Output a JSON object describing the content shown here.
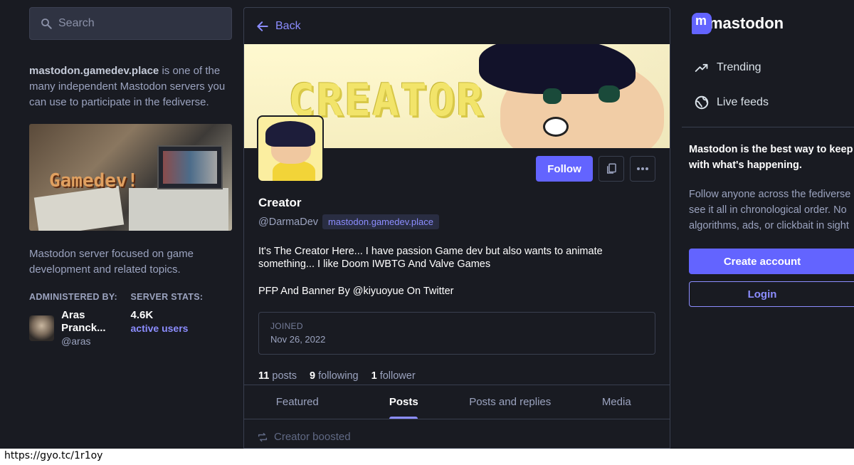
{
  "search": {
    "placeholder": "Search"
  },
  "server_info": {
    "domain": "mastodon.gamedev.place",
    "intro_rest": " is one of the many independent Mastodon servers you can use to participate in the fediverse.",
    "hero_text": "Gamedev!",
    "description": "Mastodon server focused on game development and related topics."
  },
  "admin": {
    "heading": "ADMINISTERED BY:",
    "name": "Aras Pranck...",
    "handle": "@aras"
  },
  "server_stats": {
    "heading": "SERVER STATS:",
    "value": "4.6K",
    "label": "active users"
  },
  "nav": {
    "back_label": "Back"
  },
  "banner": {
    "text": "CREATOR"
  },
  "profile": {
    "display_name": "Creator",
    "handle": "@DarmaDev",
    "domain_badge": "mastodon.gamedev.place",
    "bio_p1": "It's The Creator Here... I have passion Game dev but also wants to animate something... I like Doom IWBTG And Valve Games",
    "bio_p2": "PFP And Banner By @kiyuoyue On Twitter",
    "joined_label": "JOINED",
    "joined_date": "Nov 26, 2022",
    "follow_label": "Follow",
    "posts_count": "11",
    "posts_label": "posts",
    "following_count": "9",
    "following_label": "following",
    "followers_count": "1",
    "followers_label": "follower"
  },
  "tabs": [
    {
      "label": "Featured",
      "active": false
    },
    {
      "label": "Posts",
      "active": true
    },
    {
      "label": "Posts and replies",
      "active": false
    },
    {
      "label": "Media",
      "active": false
    }
  ],
  "timeline": {
    "boost_text": "Creator boosted"
  },
  "right": {
    "logo_text": "mastodon",
    "nav_trending": "Trending",
    "nav_live": "Live feeds",
    "pitch_strong_line1": "Mastodon is the best way to keep u",
    "pitch_strong_line2": "with what's happening.",
    "pitch_line1": "Follow anyone across the fediverse",
    "pitch_line2": "see it all in chronological order. No",
    "pitch_line3": "algorithms, ads, or clickbait in sight",
    "create_account": "Create account",
    "login": "Login"
  },
  "statusbar": {
    "url": "https://gyo.tc/1r1oy"
  },
  "colors": {
    "accent": "#6364ff",
    "link": "#8c8dff",
    "background": "#191b22"
  }
}
